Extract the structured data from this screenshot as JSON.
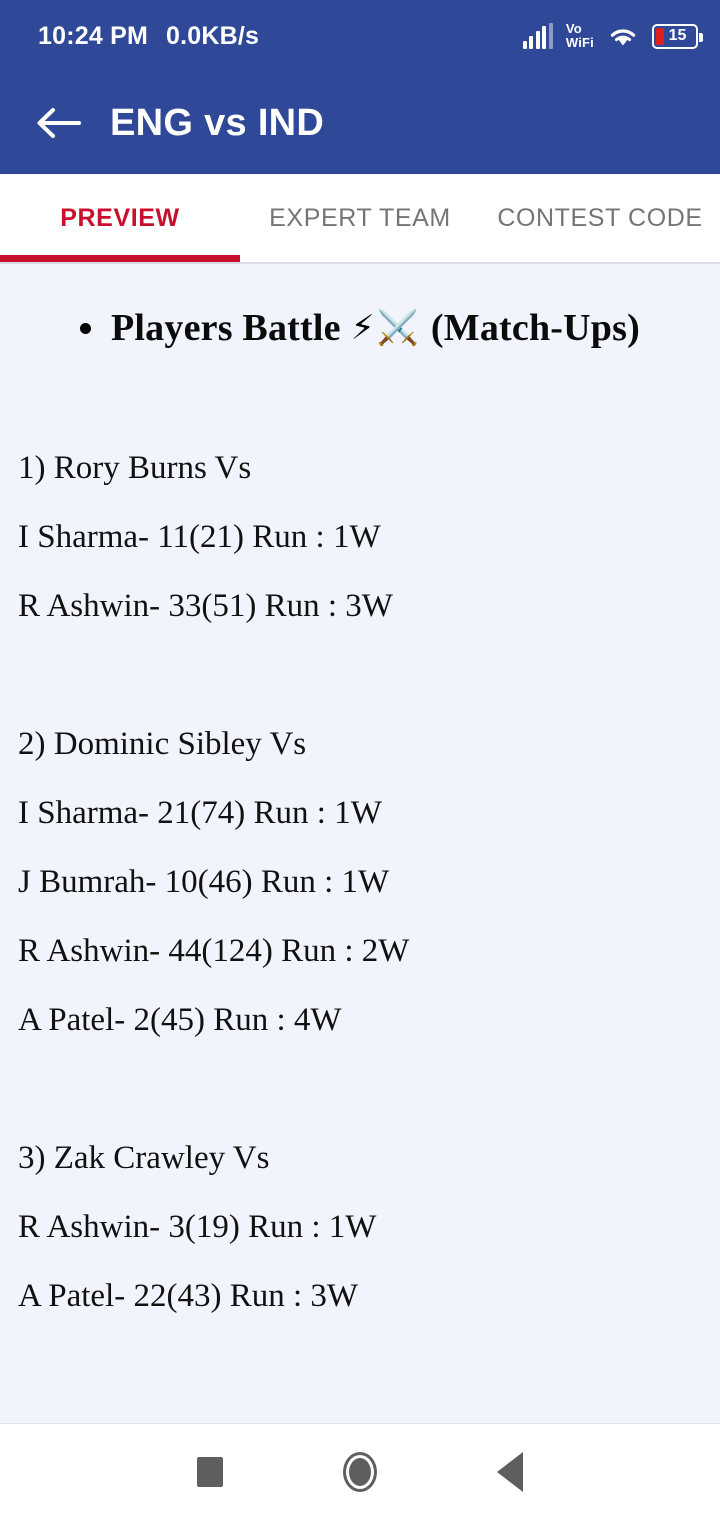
{
  "status_bar": {
    "time": "10:24 PM",
    "network_speed": "0.0KB/s",
    "vowifi_line1": "Vo",
    "vowifi_line2": "WiFi",
    "battery_level": "15"
  },
  "app_bar": {
    "title": "ENG vs IND"
  },
  "tabs": [
    {
      "label": "PREVIEW",
      "active": true
    },
    {
      "label": "EXPERT TEAM",
      "active": false
    },
    {
      "label": "CONTEST CODE",
      "active": false
    }
  ],
  "content": {
    "heading": {
      "text_before": "Players Battle",
      "emoji": "⚡⚔️",
      "text_after": "(Match-Ups)"
    },
    "battles": [
      {
        "title": "1) Rory Burns Vs",
        "lines": [
          "I Sharma- 11(21) Run : 1W",
          "R Ashwin- 33(51) Run : 3W"
        ]
      },
      {
        "title": "2) Dominic Sibley Vs",
        "lines": [
          "I Sharma- 21(74) Run : 1W",
          "J Bumrah- 10(46) Run : 1W",
          "R Ashwin- 44(124) Run : 2W",
          "A Patel- 2(45) Run : 4W"
        ]
      },
      {
        "title": "3) Zak Crawley Vs",
        "lines": [
          "R Ashwin- 3(19) Run : 1W",
          "A Patel- 22(43) Run : 3W"
        ]
      }
    ]
  },
  "nav_bar": {
    "recents": "recents",
    "home": "home",
    "back": "back"
  },
  "colors": {
    "header_blue": "#2F4898",
    "accent_red": "#C8102E",
    "content_bg": "#F1F4FD",
    "inactive_tab": "#757575",
    "battery_red": "#E02020"
  }
}
